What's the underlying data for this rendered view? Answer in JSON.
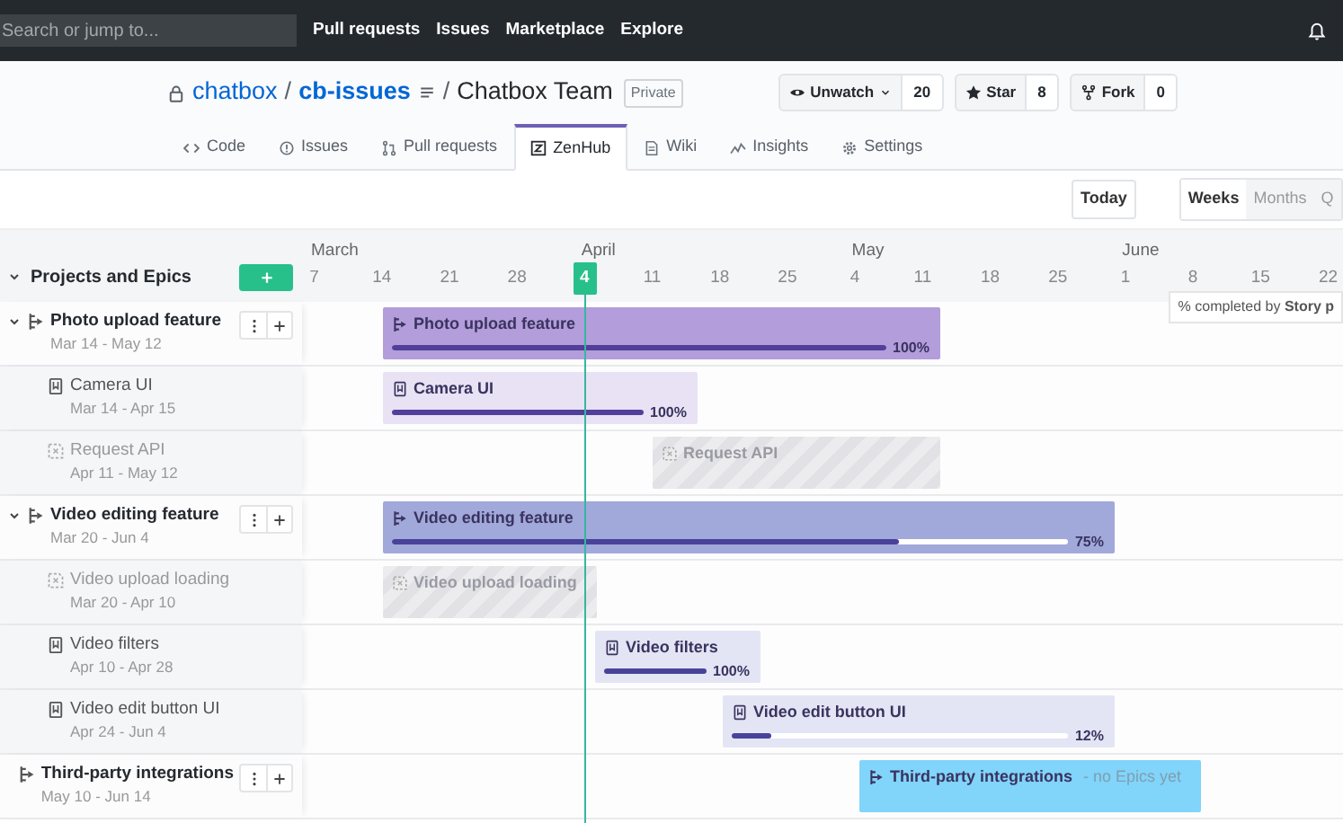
{
  "top_nav": {
    "search_placeholder": "Search or jump to...",
    "links": [
      "Pull requests",
      "Issues",
      "Marketplace",
      "Explore"
    ]
  },
  "repo": {
    "owner": "chatbox",
    "separator_1": "/",
    "name": "cb-issues",
    "separator_2": "/",
    "team": "Chatbox Team",
    "visibility": "Private",
    "actions": [
      {
        "kind": "watch",
        "label": "Unwatch",
        "count": "20"
      },
      {
        "kind": "star",
        "label": "Star",
        "count": "8"
      },
      {
        "kind": "fork",
        "label": "Fork",
        "count": "0"
      }
    ]
  },
  "tabs": [
    {
      "kind": "code",
      "label": "Code",
      "selected": false
    },
    {
      "kind": "issues",
      "label": "Issues",
      "selected": false
    },
    {
      "kind": "pulls",
      "label": "Pull requests",
      "selected": false
    },
    {
      "kind": "zenhub",
      "label": "ZenHub",
      "selected": true
    },
    {
      "kind": "wiki",
      "label": "Wiki",
      "selected": false
    },
    {
      "kind": "insights",
      "label": "Insights",
      "selected": false
    },
    {
      "kind": "settings",
      "label": "Settings",
      "selected": false
    }
  ],
  "toolbar": {
    "today": "Today",
    "scales": [
      {
        "label": "Weeks",
        "selected": true
      },
      {
        "label": "Months",
        "selected": false
      },
      {
        "label": "Q",
        "selected": false
      }
    ]
  },
  "timeline": {
    "heading": "Projects and Epics",
    "tooltip": "% completed by **Story p**",
    "months": [
      {
        "label": "March",
        "days": [
          {
            "label": "7",
            "today": false
          },
          {
            "label": "14",
            "today": false
          },
          {
            "label": "21",
            "today": false
          },
          {
            "label": "28",
            "today": false
          }
        ]
      },
      {
        "label": "April",
        "days": [
          {
            "label": "4",
            "today": true
          },
          {
            "label": "11",
            "today": false
          },
          {
            "label": "18",
            "today": false
          },
          {
            "label": "25",
            "today": false
          }
        ]
      },
      {
        "label": "May",
        "days": [
          {
            "label": "4",
            "today": false
          },
          {
            "label": "11",
            "today": false
          },
          {
            "label": "18",
            "today": false
          },
          {
            "label": "25",
            "today": false
          }
        ]
      },
      {
        "label": "June",
        "days": [
          {
            "label": "1",
            "today": false
          },
          {
            "label": "8",
            "today": false
          },
          {
            "label": "15",
            "today": false
          },
          {
            "label": "22",
            "today": false
          }
        ]
      }
    ],
    "epics": [
      {
        "title": "Photo upload feature",
        "dates": "Mar 14 - May 12",
        "color": "#b39ddb",
        "expanded": true,
        "bar": {
          "title": "Photo upload feature",
          "level": 1,
          "percent": "100%"
        },
        "children": [
          {
            "kind": "issue",
            "title": "Camera UI",
            "dates": "Mar 14 - Apr 15",
            "bar": {
              "title": "Camera UI",
              "level": 1,
              "percent": "100%"
            }
          },
          {
            "kind": "placeholder",
            "title": "Request API",
            "dates": "Apr 11 - May 12",
            "bar": {
              "title": "Request API"
            }
          }
        ]
      },
      {
        "title": "Video editing feature",
        "dates": "Mar 20 - Jun 4",
        "color": "#a1a8da",
        "expanded": true,
        "bar": {
          "title": "Video editing feature",
          "level": 0.75,
          "percent": "75%"
        },
        "children": [
          {
            "kind": "placeholder",
            "title": "Video upload loading",
            "dates": "Mar 20 - Apr 10",
            "bar": {
              "title": "Video upload loading"
            }
          },
          {
            "kind": "issue",
            "title": "Video filters",
            "dates": "Apr 10 - Apr 28",
            "bar": {
              "title": "Video filters",
              "level": 1,
              "percent": "100%"
            }
          },
          {
            "kind": "issue",
            "title": "Video edit button UI",
            "dates": "Apr 24 - Jun 4",
            "bar": {
              "title": "Video edit button UI",
              "level": 0.12,
              "percent": "12%"
            }
          }
        ]
      },
      {
        "title": "Third-party integrations",
        "dates": "May 10 - Jun 14",
        "color": "#81d4fa",
        "expanded": false,
        "bar": {
          "title": "Third-party integrations",
          "note": "- no Epics yet"
        }
      }
    ]
  }
}
